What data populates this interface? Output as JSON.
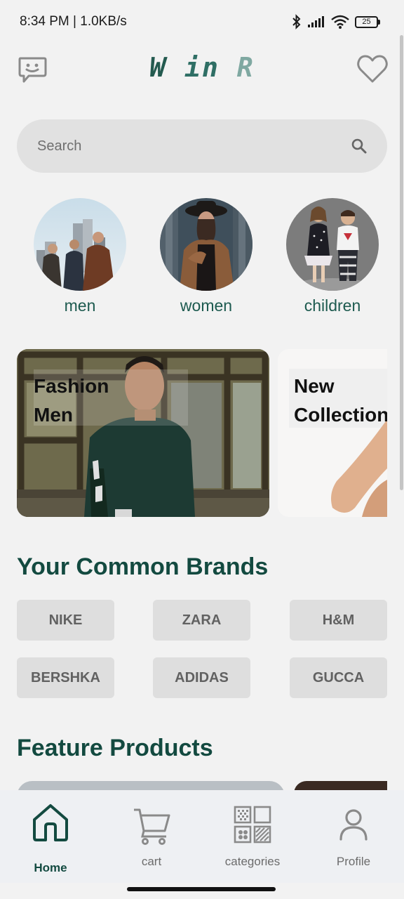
{
  "status": {
    "time_speed": "8:34 PM | 1.0KB/s",
    "battery": "25"
  },
  "header": {
    "logo": [
      "W",
      "in",
      "R"
    ]
  },
  "search": {
    "placeholder": "Search"
  },
  "categories": [
    {
      "label": "men"
    },
    {
      "label": "women"
    },
    {
      "label": "children"
    }
  ],
  "banners": [
    {
      "title": "Fashion\nMen"
    },
    {
      "title": "New\nCollection"
    }
  ],
  "brands": {
    "title": "Your Common Brands",
    "items": [
      "NIKE",
      "ZARA",
      "H&M",
      "BERSHKA",
      "ADIDAS",
      "GUCCA"
    ]
  },
  "products": {
    "title": "Feature Products"
  },
  "nav": {
    "items": [
      {
        "label": "Home",
        "active": true
      },
      {
        "label": "cart"
      },
      {
        "label": "categories"
      },
      {
        "label": "Profile"
      }
    ]
  },
  "colors": {
    "accent": "#134a40",
    "background": "#f2f2f2",
    "chip": "#dedede"
  }
}
